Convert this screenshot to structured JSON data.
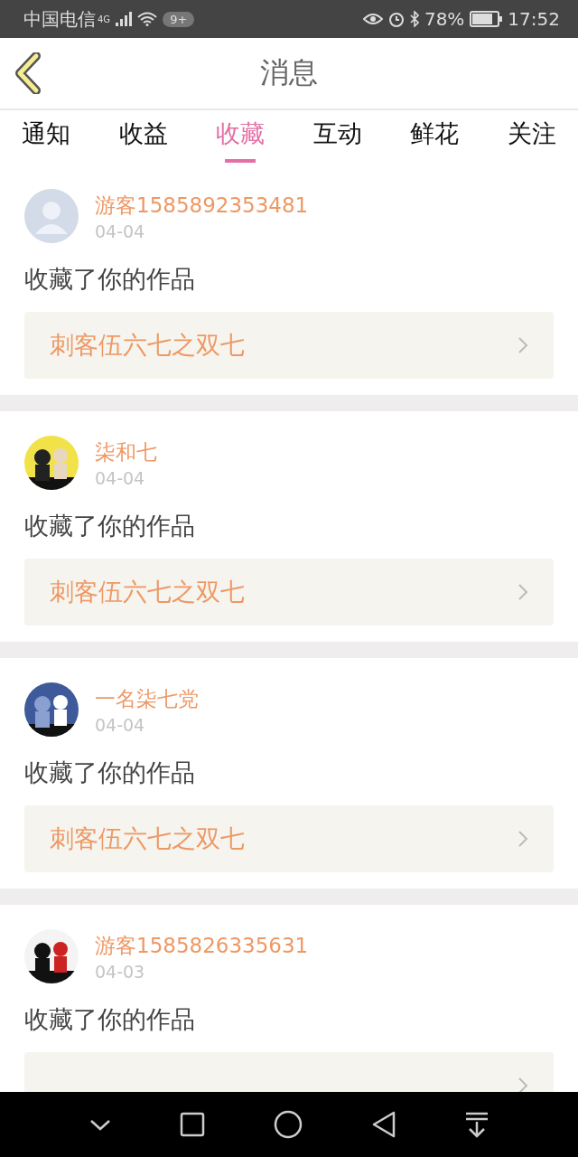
{
  "status_bar": {
    "carrier": "中国电信",
    "network": "4G",
    "badge": "9+",
    "battery": "78%",
    "time": "17:52"
  },
  "header": {
    "title": "消息"
  },
  "tabs": [
    {
      "label": "通知",
      "selected": false
    },
    {
      "label": "收益",
      "selected": false
    },
    {
      "label": "收藏",
      "selected": true
    },
    {
      "label": "互动",
      "selected": false
    },
    {
      "label": "鲜花",
      "selected": false
    },
    {
      "label": "关注",
      "selected": false
    }
  ],
  "messages": [
    {
      "avatar": {
        "kind": "default"
      },
      "user": "游客1585892353481",
      "date": "04-04",
      "action": "收藏了你的作品",
      "work": "刺客伍六七之双七"
    },
    {
      "user": "柒和七",
      "date": "04-04",
      "action": "收藏了你的作品",
      "work": "刺客伍六七之双七"
    },
    {
      "user": "一名柒七党",
      "date": "04-04",
      "action": "收藏了你的作品",
      "work": "刺客伍六七之双七"
    },
    {
      "user": "游客1585826335631",
      "date": "04-03",
      "action": "收藏了你的作品"
    }
  ]
}
